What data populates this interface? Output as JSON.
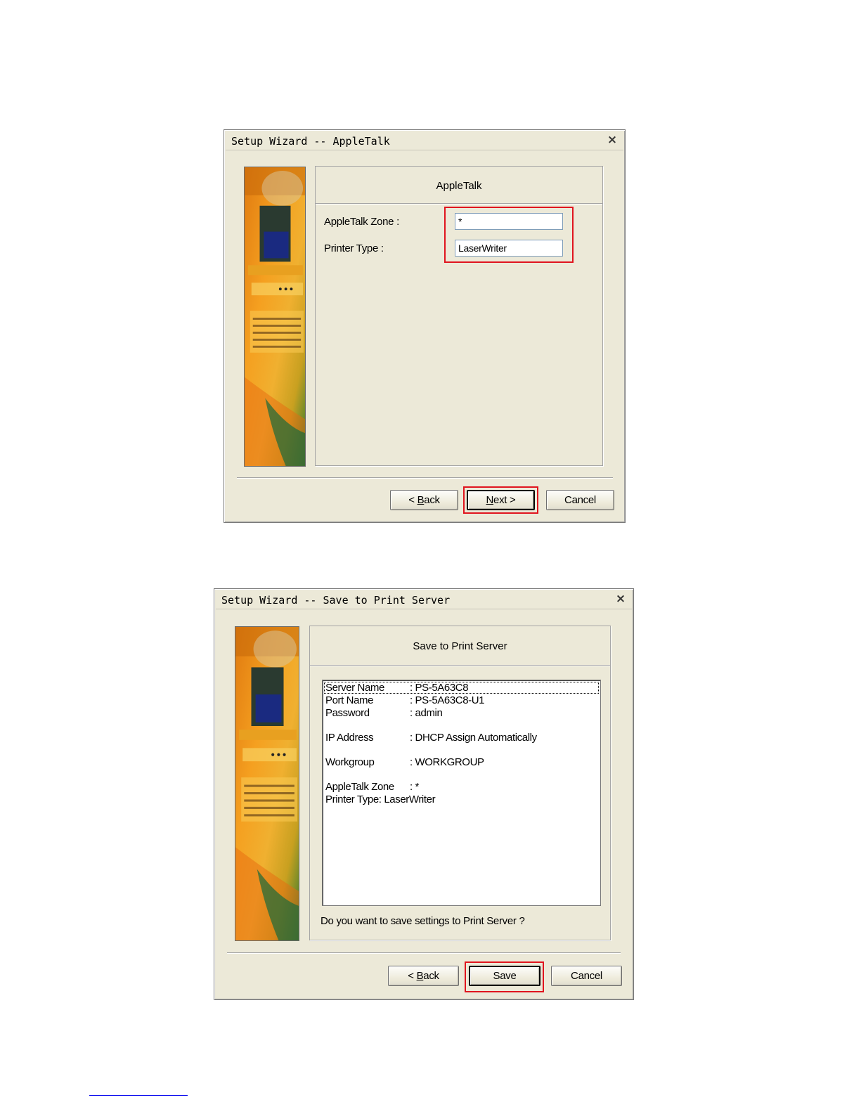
{
  "dialog1": {
    "title": "Setup Wizard -- AppleTalk",
    "close": "×",
    "heading": "AppleTalk",
    "zone_label": "AppleTalk Zone :",
    "zone_value": "*",
    "printer_label": "Printer Type :",
    "printer_value": "LaserWriter",
    "back": {
      "pre": "< ",
      "accel": "B",
      "post": "ack"
    },
    "next": {
      "pre": "",
      "accel": "N",
      "post": "ext >"
    },
    "cancel": "Cancel"
  },
  "dialog2": {
    "title": "Setup Wizard -- Save to Print Server",
    "close": "×",
    "heading": "Save to Print Server",
    "summary": [
      {
        "key": "Server Name",
        "value": ": PS-5A63C8"
      },
      {
        "key": "Port Name",
        "value": ": PS-5A63C8-U1"
      },
      {
        "key": "Password",
        "value": ": admin"
      },
      {
        "key": "IP Address",
        "value": ": DHCP Assign Automatically"
      },
      {
        "key": "Workgroup",
        "value": ": WORKGROUP"
      },
      {
        "key": "AppleTalk Zone",
        "value": ": *"
      },
      {
        "key": "Printer Type: LaserWriter",
        "value": ""
      }
    ],
    "question": "Do you want to save settings to Print Server ?",
    "back": {
      "pre": "< ",
      "accel": "B",
      "post": "ack"
    },
    "save": "Save",
    "cancel": "Cancel"
  },
  "colors": {
    "dialog_bg": "#ece9d8",
    "highlight_box": "#e0141e",
    "footer_rule": "#0000ee"
  },
  "icons": [
    "close-icon",
    "wizard-banner-image"
  ]
}
